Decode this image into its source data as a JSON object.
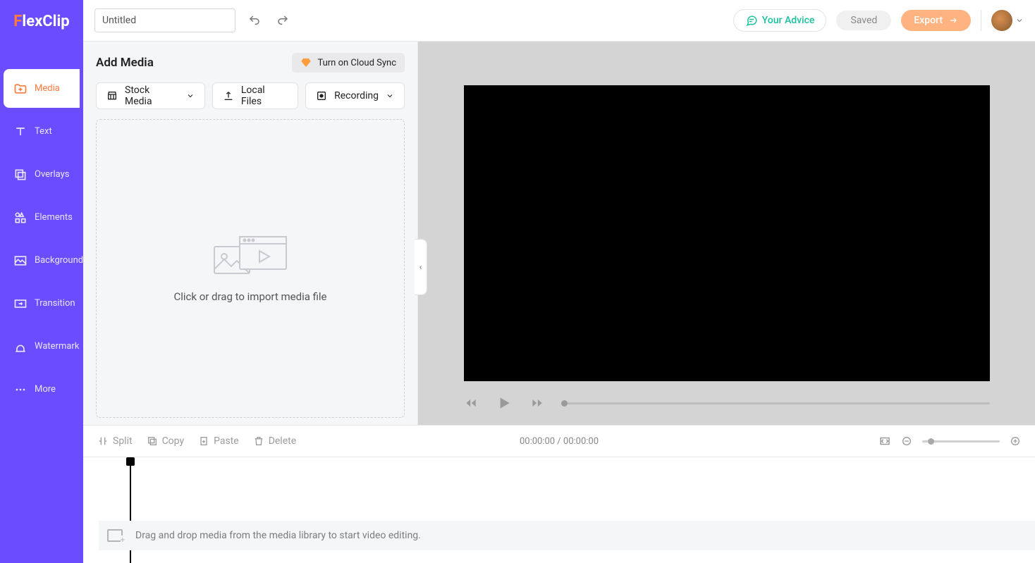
{
  "brand": {
    "part1": "F",
    "part2": "lexClip"
  },
  "topbar": {
    "title_value": "Untitled",
    "advice": "Your Advice",
    "saved": "Saved",
    "export": "Export"
  },
  "sidebar": {
    "items": [
      {
        "label": "Media"
      },
      {
        "label": "Text"
      },
      {
        "label": "Overlays"
      },
      {
        "label": "Elements"
      },
      {
        "label": "Background"
      },
      {
        "label": "Transition"
      },
      {
        "label": "Watermark"
      },
      {
        "label": "More"
      }
    ]
  },
  "media_panel": {
    "title": "Add Media",
    "cloud_sync": "Turn on Cloud Sync",
    "stock": "Stock Media",
    "local": "Local Files",
    "recording": "Recording",
    "dropzone_text": "Click or drag to import media file"
  },
  "toolbar": {
    "split": "Split",
    "copy": "Copy",
    "paste": "Paste",
    "delete": "Delete",
    "time": "00:00:00 / 00:00:00"
  },
  "timeline": {
    "hint": "Drag and drop media from the media library to start video editing."
  }
}
